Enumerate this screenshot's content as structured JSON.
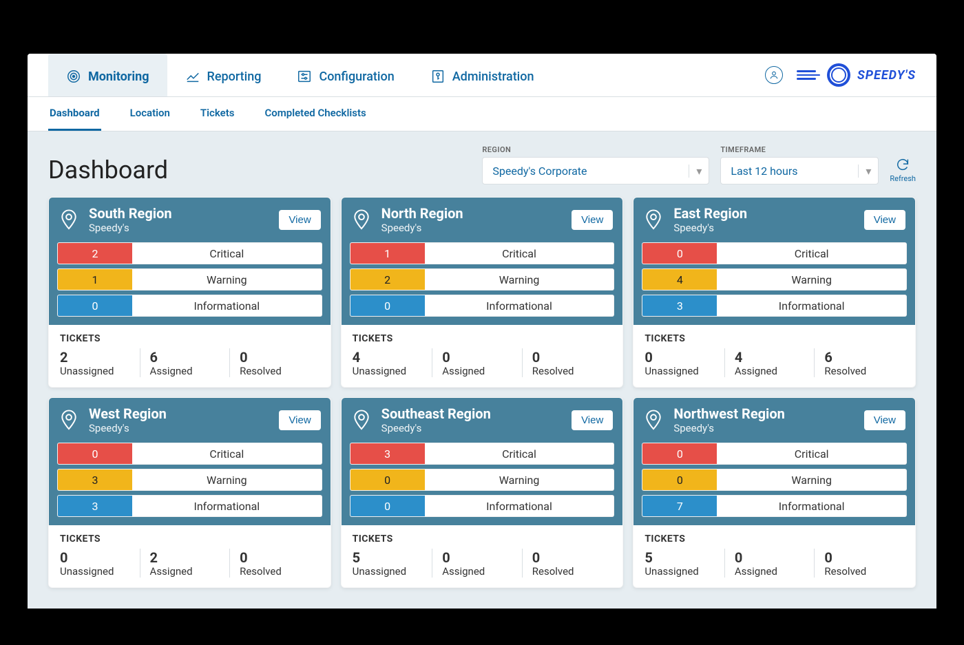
{
  "brand_name": "SPEEDY'S",
  "nav": {
    "main": [
      "Monitoring",
      "Reporting",
      "Configuration",
      "Administration"
    ],
    "main_active_index": 0,
    "sub": [
      "Dashboard",
      "Location",
      "Tickets",
      "Completed Checklists"
    ],
    "sub_active_index": 0
  },
  "page_title": "Dashboard",
  "filters": {
    "region_label": "REGION",
    "region_value": "Speedy's Corporate",
    "timeframe_label": "TIMEFRAME",
    "timeframe_value": "Last 12 hours"
  },
  "refresh_label": "Refresh",
  "status_labels": {
    "critical": "Critical",
    "warning": "Warning",
    "info": "Informational"
  },
  "tickets_heading": "TICKETS",
  "ticket_labels": {
    "unassigned": "Unassigned",
    "assigned": "Assigned",
    "resolved": "Resolved"
  },
  "view_label": "View",
  "regions": [
    {
      "name": "South Region",
      "org": "Speedy's",
      "critical": 2,
      "warning": 1,
      "info": 0,
      "unassigned": 2,
      "assigned": 6,
      "resolved": 0
    },
    {
      "name": "North Region",
      "org": "Speedy's",
      "critical": 1,
      "warning": 2,
      "info": 0,
      "unassigned": 4,
      "assigned": 0,
      "resolved": 0
    },
    {
      "name": "East Region",
      "org": "Speedy's",
      "critical": 0,
      "warning": 4,
      "info": 3,
      "unassigned": 0,
      "assigned": 4,
      "resolved": 6
    },
    {
      "name": "West Region",
      "org": "Speedy's",
      "critical": 0,
      "warning": 3,
      "info": 3,
      "unassigned": 0,
      "assigned": 2,
      "resolved": 0
    },
    {
      "name": "Southeast Region",
      "org": "Speedy's",
      "critical": 3,
      "warning": 0,
      "info": 0,
      "unassigned": 5,
      "assigned": 0,
      "resolved": 0
    },
    {
      "name": "Northwest Region",
      "org": "Speedy's",
      "critical": 0,
      "warning": 0,
      "info": 7,
      "unassigned": 5,
      "assigned": 0,
      "resolved": 0
    }
  ],
  "colors": {
    "critical": "#e64f48",
    "warning": "#f1b51b",
    "info": "#2c8fca"
  }
}
